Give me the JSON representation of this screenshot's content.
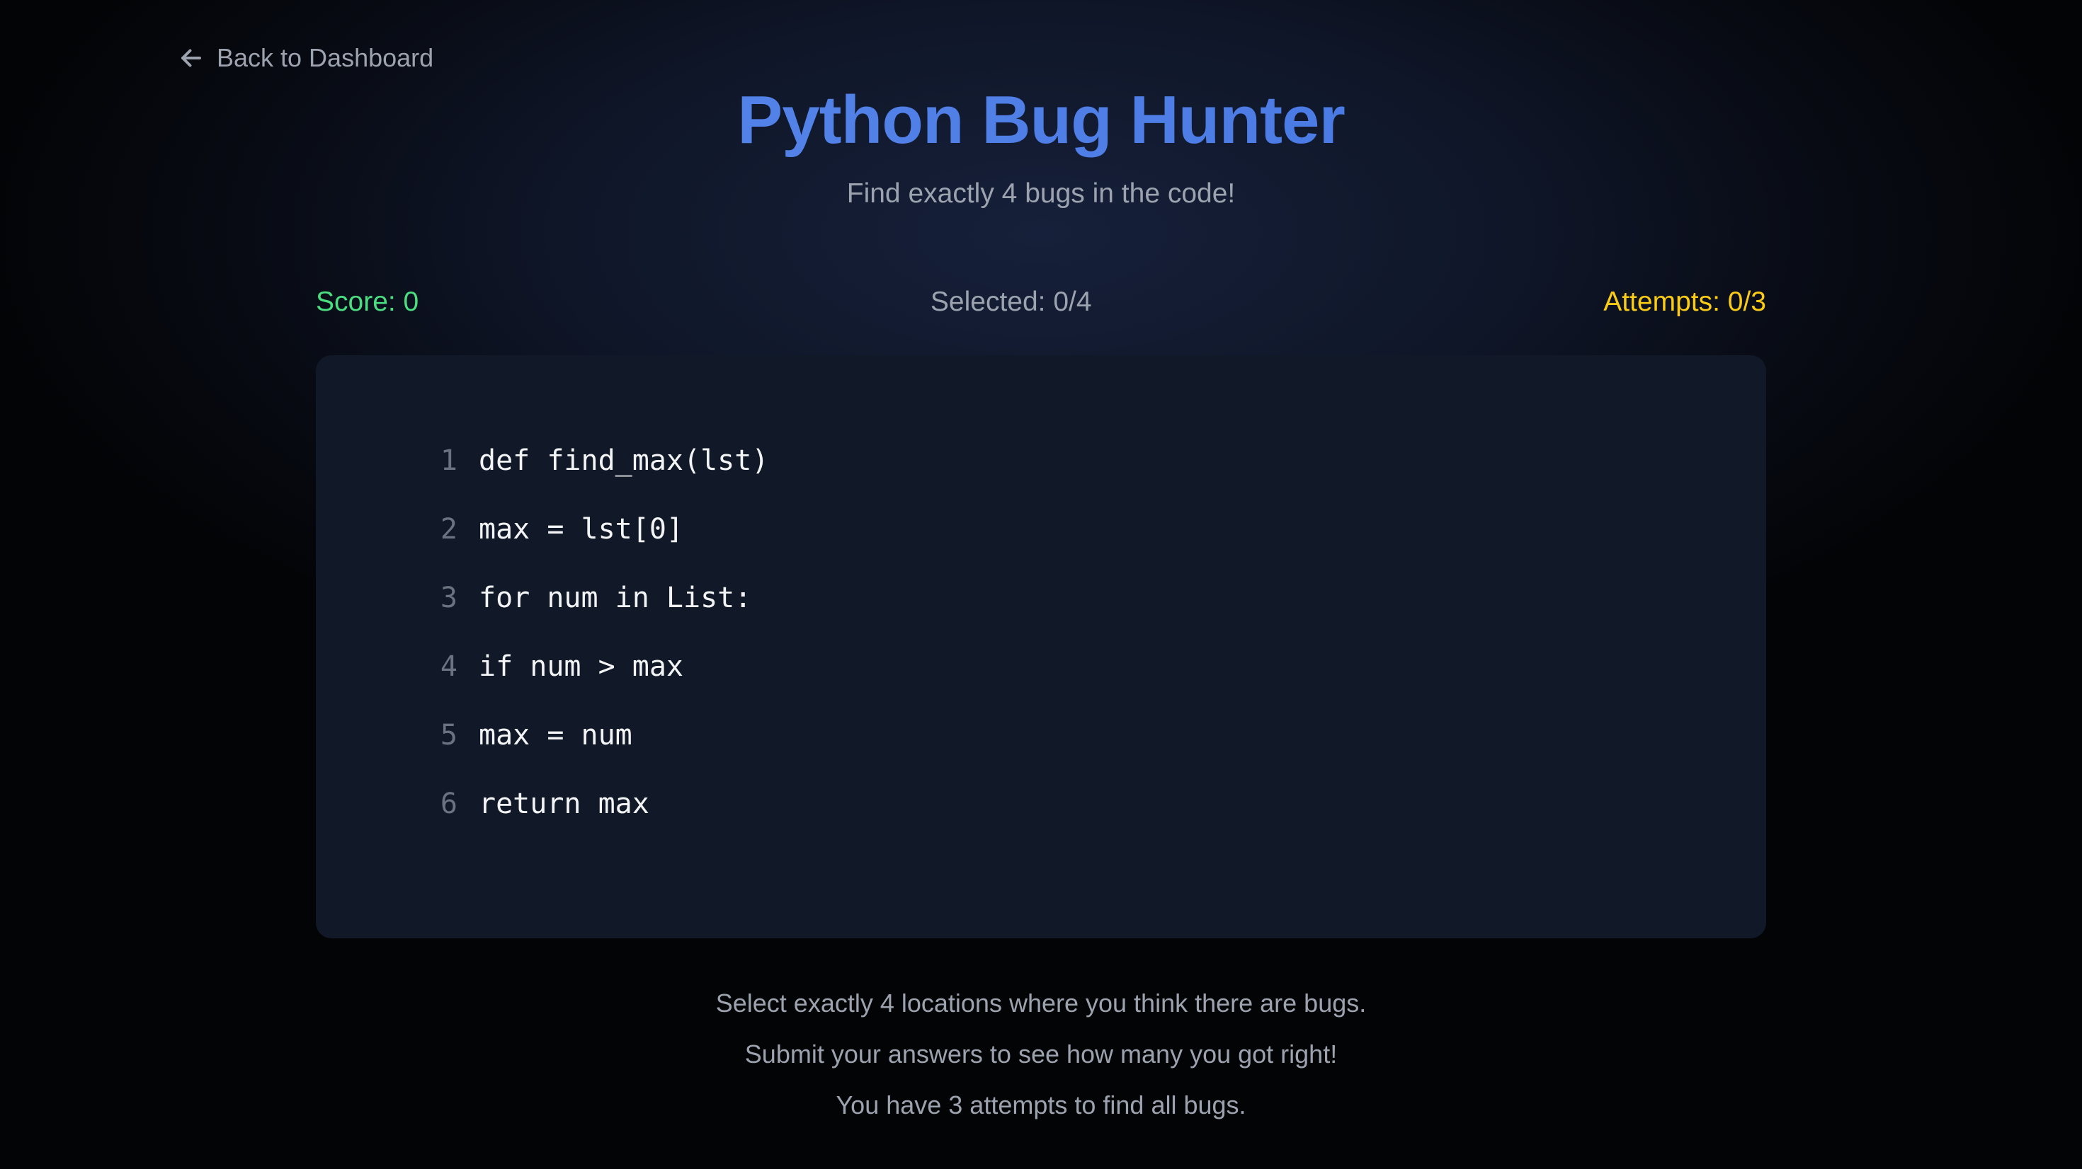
{
  "nav": {
    "back_label": "Back to Dashboard",
    "back_icon": "arrow-left-icon"
  },
  "header": {
    "title": "Python Bug Hunter",
    "subtitle": "Find exactly 4 bugs in the code!"
  },
  "stats": {
    "score": "Score: 0",
    "selected": "Selected: 0/4",
    "attempts": "Attempts: 0/3"
  },
  "code": {
    "lines": [
      {
        "num": "1",
        "text": "def find_max(lst)"
      },
      {
        "num": "2",
        "text": "max = lst[0]"
      },
      {
        "num": "3",
        "text": "for num in List:"
      },
      {
        "num": "4",
        "text": "if num > max"
      },
      {
        "num": "5",
        "text": "max = num"
      },
      {
        "num": "6",
        "text": "return max"
      }
    ]
  },
  "instructions": [
    "Select exactly 4 locations where you think there are bugs.",
    "Submit your answers to see how many you got right!",
    "You have 3 attempts to find all bugs."
  ],
  "colors": {
    "title": "#4f7fe6",
    "score": "#4ade80",
    "attempts": "#facc15",
    "panel": "#111827"
  }
}
